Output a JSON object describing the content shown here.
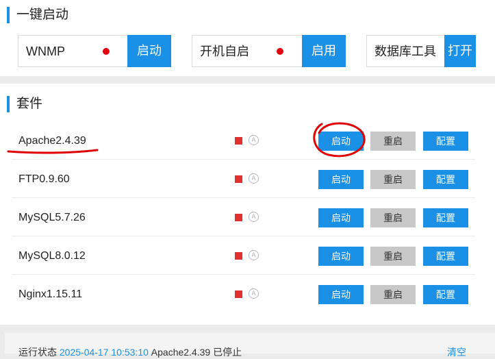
{
  "quick_start": {
    "title": "一键启动",
    "cards": [
      {
        "label": "WNMP",
        "status_color": "#e60012",
        "button": "启动"
      },
      {
        "label": "开机自启",
        "status_color": "#e60012",
        "button": "启用"
      },
      {
        "label": "数据库工具",
        "button": "打开"
      }
    ]
  },
  "suite": {
    "title": "套件",
    "auto_icon_glyph": "A",
    "stopped_color": "#e03030",
    "rows": [
      {
        "name": "Apache2.4.39",
        "start": "启动",
        "restart": "重启",
        "config": "配置"
      },
      {
        "name": "FTP0.9.60",
        "start": "启动",
        "restart": "重启",
        "config": "配置"
      },
      {
        "name": "MySQL5.7.26",
        "start": "启动",
        "restart": "重启",
        "config": "配置"
      },
      {
        "name": "MySQL8.0.12",
        "start": "启动",
        "restart": "重启",
        "config": "配置"
      },
      {
        "name": "Nginx1.15.11",
        "start": "启动",
        "restart": "重启",
        "config": "配置"
      }
    ]
  },
  "status_bar": {
    "prefix": "运行状态",
    "timestamp": "2025-04-17 10:53:10",
    "message": "Apache2.4.39 已停止",
    "right_link": "清空"
  },
  "colors": {
    "accent": "#1a90e6",
    "annotation": "#e00000"
  }
}
